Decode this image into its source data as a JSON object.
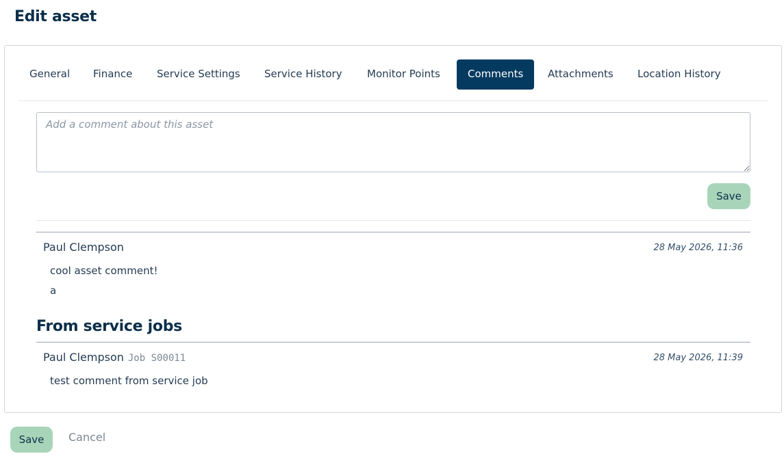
{
  "page": {
    "title": "Edit asset"
  },
  "tabs": [
    {
      "label": "General"
    },
    {
      "label": "Finance"
    },
    {
      "label": "Service Settings"
    },
    {
      "label": "Service History"
    },
    {
      "label": "Monitor Points"
    },
    {
      "label": "Comments",
      "active": true
    },
    {
      "label": "Attachments"
    },
    {
      "label": "Location History"
    }
  ],
  "comment_form": {
    "placeholder": "Add a comment about this asset",
    "value": "",
    "save_label": "Save"
  },
  "comments": [
    {
      "author": "Paul Clempson",
      "timestamp": "28 May 2026, 11:36",
      "lines": [
        "cool asset comment!",
        "a"
      ]
    }
  ],
  "service_jobs": {
    "heading": "From service jobs",
    "comments": [
      {
        "author": "Paul Clempson",
        "job": "Job S00011",
        "timestamp": "28 May 2026, 11:39",
        "lines": [
          "test comment from service job"
        ]
      }
    ]
  },
  "footer": {
    "save_label": "Save",
    "cancel_label": "Cancel"
  },
  "colors": {
    "accent": "#053a60",
    "save_button": "#a8d5b9",
    "text": "#243b53"
  }
}
